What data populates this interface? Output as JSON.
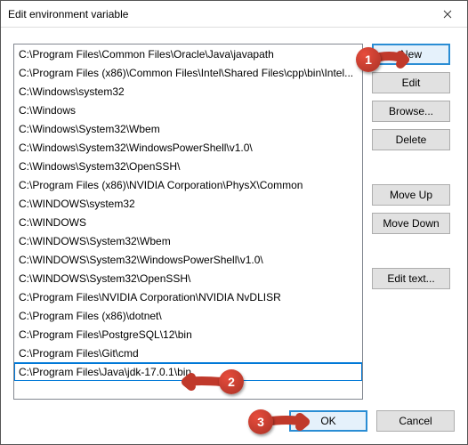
{
  "window": {
    "title": "Edit environment variable"
  },
  "list": {
    "items": [
      "C:\\Program Files\\Common Files\\Oracle\\Java\\javapath",
      "C:\\Program Files (x86)\\Common Files\\Intel\\Shared Files\\cpp\\bin\\Intel...",
      "C:\\Windows\\system32",
      "C:\\Windows",
      "C:\\Windows\\System32\\Wbem",
      "C:\\Windows\\System32\\WindowsPowerShell\\v1.0\\",
      "C:\\Windows\\System32\\OpenSSH\\",
      "C:\\Program Files (x86)\\NVIDIA Corporation\\PhysX\\Common",
      "C:\\WINDOWS\\system32",
      "C:\\WINDOWS",
      "C:\\WINDOWS\\System32\\Wbem",
      "C:\\WINDOWS\\System32\\WindowsPowerShell\\v1.0\\",
      "C:\\WINDOWS\\System32\\OpenSSH\\",
      "C:\\Program Files\\NVIDIA Corporation\\NVIDIA NvDLISR",
      "C:\\Program Files (x86)\\dotnet\\",
      "C:\\Program Files\\PostgreSQL\\12\\bin",
      "C:\\Program Files\\Git\\cmd"
    ],
    "editing_value": "C:\\Program Files\\Java\\jdk-17.0.1\\bin"
  },
  "buttons": {
    "new": "New",
    "edit": "Edit",
    "browse": "Browse...",
    "delete": "Delete",
    "move_up": "Move Up",
    "move_down": "Move Down",
    "edit_text": "Edit text...",
    "ok": "OK",
    "cancel": "Cancel"
  },
  "callouts": {
    "c1": "1",
    "c2": "2",
    "c3": "3"
  }
}
